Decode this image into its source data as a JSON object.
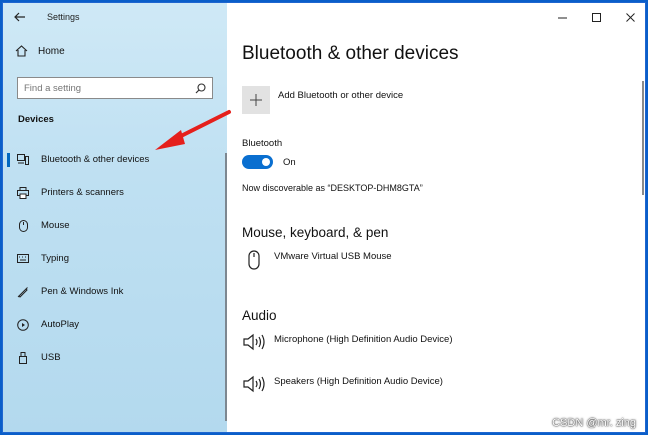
{
  "window": {
    "title": "Settings"
  },
  "sidebar": {
    "home_label": "Home",
    "search_placeholder": "Find a setting",
    "section_label": "Devices",
    "items": [
      {
        "label": "Bluetooth & other devices",
        "icon": "bluetooth-devices-icon",
        "active": true
      },
      {
        "label": "Printers & scanners",
        "icon": "printer-icon"
      },
      {
        "label": "Mouse",
        "icon": "mouse-icon"
      },
      {
        "label": "Typing",
        "icon": "keyboard-icon"
      },
      {
        "label": "Pen & Windows Ink",
        "icon": "pen-icon"
      },
      {
        "label": "AutoPlay",
        "icon": "autoplay-icon"
      },
      {
        "label": "USB",
        "icon": "usb-icon"
      }
    ]
  },
  "main": {
    "title": "Bluetooth & other devices",
    "add_device_label": "Add Bluetooth or other device",
    "bluetooth_label": "Bluetooth",
    "bluetooth_state": "On",
    "discoverable_text": "Now discoverable as “DESKTOP-DHM8GTA”",
    "sections": {
      "mouse_heading": "Mouse, keyboard, & pen",
      "mouse_device": "VMware Virtual USB Mouse",
      "audio_heading": "Audio",
      "audio_devices": [
        "Microphone (High Definition Audio Device)",
        "Speakers (High Definition Audio Device)"
      ]
    }
  },
  "watermark": "CSDN @mr. zing",
  "colors": {
    "accent": "#0a6fd0",
    "arrow": "#e5201c",
    "border": "#1e66d0"
  }
}
